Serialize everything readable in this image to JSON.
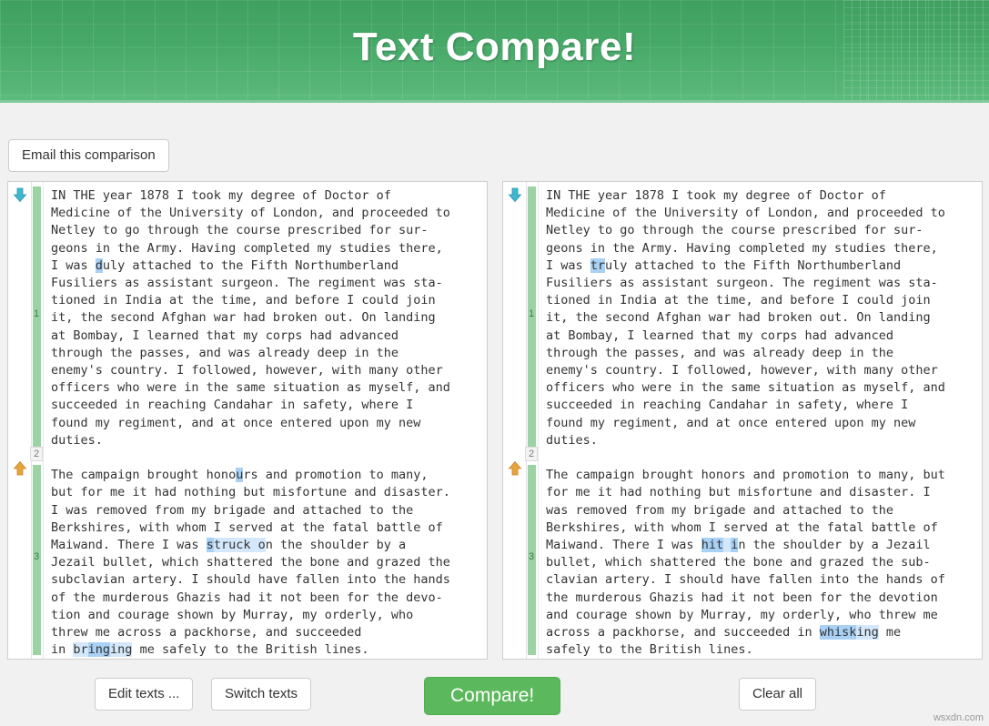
{
  "header": {
    "title": "Text Compare!"
  },
  "toolbar": {
    "email_label": "Email this comparison"
  },
  "footer": {
    "edit_label": "Edit texts ...",
    "switch_label": "Switch texts",
    "compare_label": "Compare!",
    "clear_label": "Clear all"
  },
  "watermark": "wsxdn.com",
  "colors": {
    "header_green": "#47a968",
    "compare_green": "#5cb85c",
    "change_bar_green": "#9cd3a5",
    "highlight_light": "#d4e7fb",
    "highlight_dark": "#a8d1f5",
    "arrow_down_blue": "#3eb8d0",
    "arrow_up_orange": "#e8a33d"
  },
  "markers": {
    "left": [
      "1",
      "2",
      "3"
    ],
    "right": [
      "1",
      "2",
      "3"
    ]
  },
  "icons": {
    "arrow_down": "arrow-down-icon",
    "arrow_up": "arrow-up-icon"
  },
  "panes": {
    "left": {
      "lines": [
        [
          {
            "t": "IN THE year 1878 I took my degree of Doctor of"
          }
        ],
        [
          {
            "t": "Medicine of the University of London, and proceeded to"
          }
        ],
        [
          {
            "t": "Netley to go through the course prescribed for sur-"
          }
        ],
        [
          {
            "t": "geons in the Army. Having completed my studies there,"
          }
        ],
        [
          {
            "t": "I was "
          },
          {
            "t": "d",
            "h": "dark"
          },
          {
            "t": "uly attached to the Fifth Northumberland"
          }
        ],
        [
          {
            "t": "Fusiliers as assistant surgeon. The regiment was sta-"
          }
        ],
        [
          {
            "t": "tioned in India at the time, and before I could join"
          }
        ],
        [
          {
            "t": "it, the second Afghan war had broken out. On landing"
          }
        ],
        [
          {
            "t": "at Bombay, I learned that my corps had advanced"
          }
        ],
        [
          {
            "t": "through the passes, and was already deep in the"
          }
        ],
        [
          {
            "t": "enemy's country. I followed, however, with many other"
          }
        ],
        [
          {
            "t": "officers who were in the same situation as myself, and"
          }
        ],
        [
          {
            "t": "succeeded in reaching Candahar in safety, where I"
          }
        ],
        [
          {
            "t": "found my regiment, and at once entered upon my new"
          }
        ],
        [
          {
            "t": "duties."
          }
        ],
        [
          {
            "t": ""
          }
        ],
        [
          {
            "t": "The campaign brought hono"
          },
          {
            "t": "u",
            "h": "dark"
          },
          {
            "t": "rs and promotion to many,"
          }
        ],
        [
          {
            "t": "but for me it had nothing but misfortune and disaster."
          }
        ],
        [
          {
            "t": "I was removed from my brigade and attached to the"
          }
        ],
        [
          {
            "t": "Berkshires, with whom I served at the fatal battle of"
          }
        ],
        [
          {
            "t": "Maiwand. There I was "
          },
          {
            "t": "s",
            "h": "dark"
          },
          {
            "t": "truck o",
            "h": "light"
          },
          {
            "t": "n the shoulder by a"
          }
        ],
        [
          {
            "t": "Jezail bullet, which shattered the bone and grazed the"
          }
        ],
        [
          {
            "t": "subclavian artery. I should have fallen into the hands"
          }
        ],
        [
          {
            "t": "of the murderous Ghazis had it not been for the devo-"
          }
        ],
        [
          {
            "t": "tion and courage shown by Murray, my orderly, who"
          }
        ],
        [
          {
            "t": "threw me across a packhorse, and succeeded"
          }
        ],
        [
          {
            "t": "in "
          },
          {
            "t": "br",
            "h": "light"
          },
          {
            "t": "ing",
            "h": "dark"
          },
          {
            "t": "ing",
            "h": "light"
          },
          {
            "t": " me safely to the British lines."
          }
        ]
      ]
    },
    "right": {
      "lines": [
        [
          {
            "t": "IN THE year 1878 I took my degree of Doctor of"
          }
        ],
        [
          {
            "t": "Medicine of the University of London, and proceeded to"
          }
        ],
        [
          {
            "t": "Netley to go through the course prescribed for sur-"
          }
        ],
        [
          {
            "t": "geons in the Army. Having completed my studies there,"
          }
        ],
        [
          {
            "t": "I was "
          },
          {
            "t": "tr",
            "h": "dark"
          },
          {
            "t": "uly attached to the Fifth Northumberland"
          }
        ],
        [
          {
            "t": "Fusiliers as assistant surgeon. The regiment was sta-"
          }
        ],
        [
          {
            "t": "tioned in India at the time, and before I could join"
          }
        ],
        [
          {
            "t": "it, the second Afghan war had broken out. On landing"
          }
        ],
        [
          {
            "t": "at Bombay, I learned that my corps had advanced"
          }
        ],
        [
          {
            "t": "through the passes, and was already deep in the"
          }
        ],
        [
          {
            "t": "enemy's country. I followed, however, with many other"
          }
        ],
        [
          {
            "t": "officers who were in the same situation as myself, and"
          }
        ],
        [
          {
            "t": "succeeded in reaching Candahar in safety, where I"
          }
        ],
        [
          {
            "t": "found my regiment, and at once entered upon my new"
          }
        ],
        [
          {
            "t": "duties."
          }
        ],
        [
          {
            "t": ""
          }
        ],
        [
          {
            "t": "The campaign brought honors and promotion to many, but"
          }
        ],
        [
          {
            "t": "for me it had nothing but misfortune and disaster. I"
          }
        ],
        [
          {
            "t": "was removed from my brigade and attached to the"
          }
        ],
        [
          {
            "t": "Berkshires, with whom I served at the fatal battle of"
          }
        ],
        [
          {
            "t": "Maiwand. There I was "
          },
          {
            "t": "hit",
            "h": "dark"
          },
          {
            "t": " ",
            "h": "light"
          },
          {
            "t": "i",
            "h": "dark"
          },
          {
            "t": "n the shoulder by a Jezail"
          }
        ],
        [
          {
            "t": "bullet, which shattered the bone and grazed the sub-"
          }
        ],
        [
          {
            "t": "clavian artery. I should have fallen into the hands of"
          }
        ],
        [
          {
            "t": "the murderous Ghazis had it not been for the devotion"
          }
        ],
        [
          {
            "t": "and courage shown by Murray, my orderly, who threw me"
          }
        ],
        [
          {
            "t": "across a packhorse, and succeeded in "
          },
          {
            "t": "whisk",
            "h": "dark"
          },
          {
            "t": "ing",
            "h": "light"
          },
          {
            "t": " me"
          }
        ],
        [
          {
            "t": "safely to the British lines."
          }
        ]
      ]
    }
  }
}
